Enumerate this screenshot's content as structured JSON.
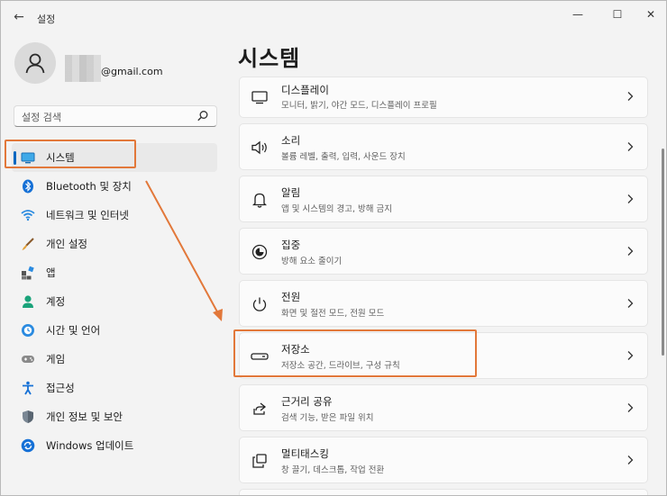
{
  "app": {
    "title": "설정",
    "back_glyph": "←",
    "minimize_glyph": "—",
    "maximize_glyph": "☐",
    "close_glyph": "✕"
  },
  "account": {
    "email_suffix": "@gmail.com"
  },
  "search": {
    "placeholder": "설정 검색"
  },
  "sidebar": {
    "items": [
      {
        "label": "시스템",
        "icon": "monitor-icon",
        "active": true
      },
      {
        "label": "Bluetooth 및 장치",
        "icon": "bluetooth-icon"
      },
      {
        "label": "네트워크 및 인터넷",
        "icon": "wifi-icon"
      },
      {
        "label": "개인 설정",
        "icon": "brush-icon"
      },
      {
        "label": "앱",
        "icon": "apps-icon"
      },
      {
        "label": "계정",
        "icon": "person-icon"
      },
      {
        "label": "시간 및 언어",
        "icon": "globe-clock-icon"
      },
      {
        "label": "게임",
        "icon": "gamepad-icon"
      },
      {
        "label": "접근성",
        "icon": "accessibility-icon"
      },
      {
        "label": "개인 정보 및 보안",
        "icon": "shield-icon"
      },
      {
        "label": "Windows 업데이트",
        "icon": "update-icon"
      }
    ]
  },
  "main": {
    "title": "시스템",
    "cards": [
      {
        "title": "디스플레이",
        "subtitle": "모니터, 밝기, 야간 모드, 디스플레이 프로필",
        "icon": "display-icon"
      },
      {
        "title": "소리",
        "subtitle": "볼륨 레벨, 출력, 입력, 사운드 장치",
        "icon": "speaker-icon"
      },
      {
        "title": "알림",
        "subtitle": "앱 및 시스템의 경고, 방해 금지",
        "icon": "bell-icon"
      },
      {
        "title": "집중",
        "subtitle": "방해 요소 줄이기",
        "icon": "focus-icon"
      },
      {
        "title": "전원",
        "subtitle": "화면 및 절전 모드, 전원 모드",
        "icon": "power-icon"
      },
      {
        "title": "저장소",
        "subtitle": "저장소 공간, 드라이브, 구성 규칙",
        "icon": "storage-icon"
      },
      {
        "title": "근거리 공유",
        "subtitle": "검색 기능, 받은 파일 위치",
        "icon": "share-icon"
      },
      {
        "title": "멀티태스킹",
        "subtitle": "창 끌기, 데스크톱, 작업 전환",
        "icon": "multitask-icon"
      }
    ]
  },
  "colors": {
    "accent": "#0067c0",
    "highlight": "#e2783a"
  }
}
